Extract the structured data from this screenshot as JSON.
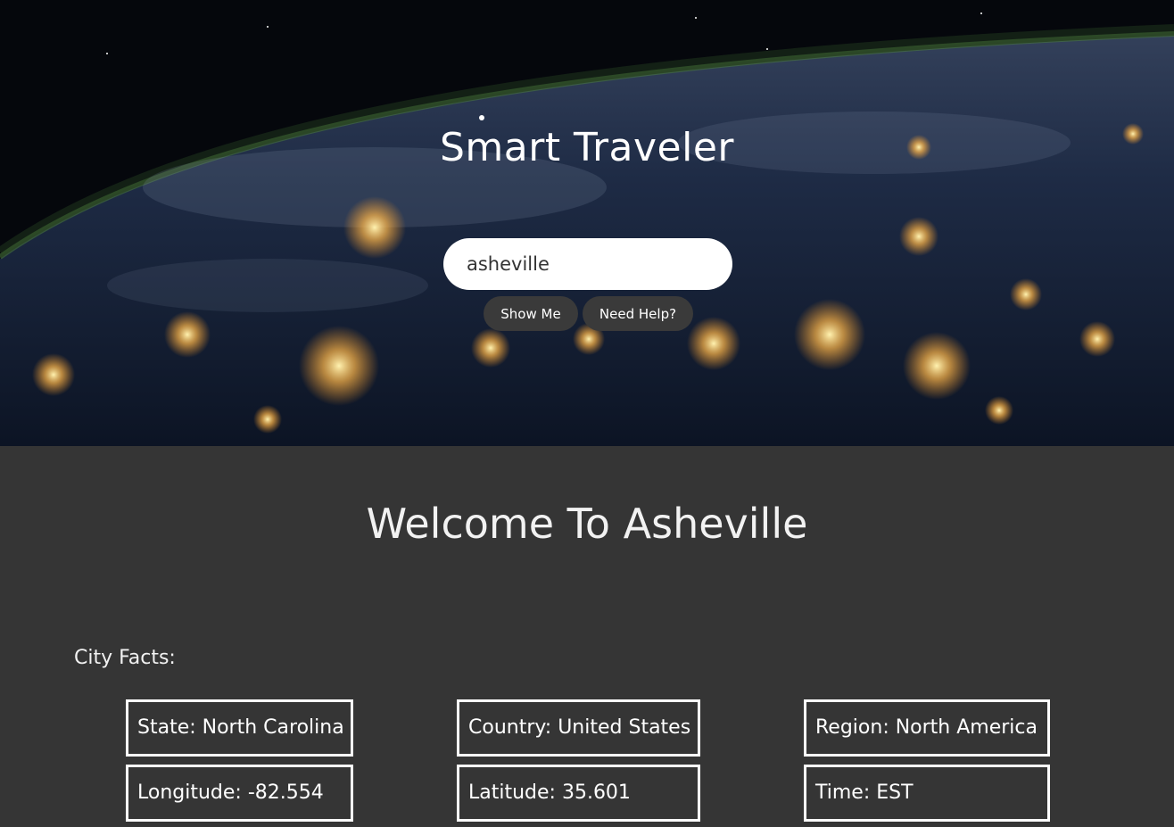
{
  "header": {
    "title": "Smart Traveler"
  },
  "search": {
    "value": "asheville",
    "placeholder": ""
  },
  "buttons": {
    "show_me": "Show Me",
    "need_help": "Need Help?"
  },
  "main": {
    "welcome": "Welcome To Asheville",
    "facts_label": "City Facts:",
    "facts": {
      "state": "State: North Carolina",
      "country": "Country: United States",
      "region": "Region: North America",
      "longitude": "Longitude: -82.554",
      "latitude": "Latitude: 35.601",
      "time": "Time: EST"
    }
  },
  "colors": {
    "page_background": "#353535",
    "button_background": "#3a3a3a",
    "text": "#ffffff"
  }
}
